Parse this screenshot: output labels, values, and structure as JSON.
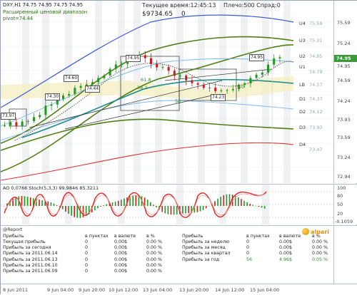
{
  "header": {
    "symbol_line": "DXY,H1  74.75 74.95 74.75 74.95",
    "indicator_name": "Расширенный ценовой диапазон",
    "pivot_label": "pivot=74.44",
    "server_time": "Текущее время:12:45:13",
    "spread_info": "Плечо:500  Спрэд:0",
    "balance": "$9734.65",
    "zero_value": "0"
  },
  "price_axis": {
    "ticks": [
      "75.59",
      "75.24",
      "74.95",
      "74.59",
      "74.24",
      "73.93",
      "73.59",
      "73.24",
      "72.94"
    ],
    "current_price": "74.95"
  },
  "levels": {
    "labels": [
      "U4",
      "U3",
      "U2",
      "U1",
      "LB",
      "D1",
      "D2",
      "D3",
      "D4"
    ],
    "right_values": [
      "75.59",
      "75.31",
      "74.95",
      "74.79",
      "74.57",
      "74.37",
      "74.12",
      "73.93",
      "73.47"
    ]
  },
  "annotations": {
    "price_boxes": [
      "74.95",
      "74.60",
      "74.44",
      "74.30",
      "74.23",
      "74.95",
      "73.97"
    ],
    "fib_values": [
      "61.8",
      "38.2",
      "50",
      "50"
    ]
  },
  "oscillator": {
    "header": "AO 0.0766  Stoch(5,3,3) 99.9846 85.3211",
    "axis_ticks": [
      "100",
      "80",
      "50",
      "20",
      "-0.1059"
    ]
  },
  "report": {
    "title": "@Report",
    "left_columns": [
      "Прибыль",
      "в пунктах",
      "в валюте",
      "в %"
    ],
    "left_rows": [
      {
        "label": "Текущая прибыль",
        "points": "0",
        "money": "0.00$",
        "pct": "0.00 %"
      },
      {
        "label": "Прибыль за сегодня",
        "points": "0",
        "money": "0.00$",
        "pct": "0.00 %"
      },
      {
        "label": "Прибыль за 2011.06.14",
        "points": "0",
        "money": "0.00$",
        "pct": "0.00 %"
      },
      {
        "label": "Прибыль за 2011.06.13",
        "points": "0",
        "money": "0.00$",
        "pct": "0.00 %"
      },
      {
        "label": "Прибыль за 2011.06.10",
        "points": "0",
        "money": "0.00$",
        "pct": "0.00 %"
      },
      {
        "label": "Прибыль за 2011.06.09",
        "points": "0",
        "money": "0.00$",
        "pct": "0.00 %"
      }
    ],
    "right_columns": [
      "Прибыль",
      "в пунктах",
      "в валюте",
      "в %"
    ],
    "right_rows": [
      {
        "label": "Прибыль за неделю",
        "points": "0",
        "money": "0.00$",
        "pct": "0.00 %"
      },
      {
        "label": "Прибыль за месяц",
        "points": "0",
        "money": "0.00$",
        "pct": "0.00 %"
      },
      {
        "label": "Прибыль за квартал",
        "points": "0",
        "money": "0.00$",
        "pct": "0.00 %"
      },
      {
        "label": "Прибыль за год",
        "points": "56",
        "money": "4.96$",
        "pct": "0.05 %"
      }
    ]
  },
  "time_axis": {
    "labels": [
      "8 Jun 2011",
      "9 Jun 04:00",
      "9 Jun 20:00",
      "10 Jun 12:00",
      "13 Jun 04:00",
      "13 Jun 20:00",
      "14 Jun 12:00",
      "15 Jun 04:00"
    ]
  },
  "branding": {
    "logo_text": "alpari"
  },
  "colors": {
    "candle_up": "#1f9a1f",
    "candle_down": "#d11a1a",
    "band_green": "#4e7f10",
    "band_blue": "#3a5bd9",
    "band_red": "#e03030",
    "lb_teal": "#1a8a8a",
    "price_tag": "#3a9a3a"
  }
}
